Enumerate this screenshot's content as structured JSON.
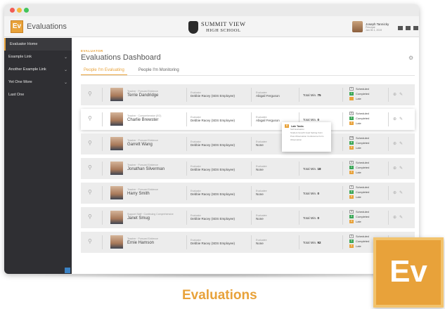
{
  "app": {
    "badge": "Ev",
    "title": "Evaluations"
  },
  "school": {
    "name": "SUMMIT VIEW",
    "sub": "HIGH SCHOOL"
  },
  "user": {
    "name": "Joseph Tannicky",
    "role": "Principal",
    "meta": "Jan 06 1, 2019"
  },
  "sidebar": {
    "items": [
      {
        "label": "Evaluator Home",
        "chevron": false
      },
      {
        "label": "Example Link",
        "chevron": true
      },
      {
        "label": "Another Example Link",
        "chevron": true
      },
      {
        "label": "Yet One More",
        "chevron": true
      },
      {
        "label": "Last One",
        "chevron": false
      }
    ]
  },
  "page": {
    "eyebrow": "EVALUATOR",
    "title": "Evaluations Dashboard"
  },
  "tabs": [
    "People I'm Evaluating",
    "People I'm Monitoring"
  ],
  "labels": {
    "evaluator": "Evaluator",
    "evaluatee": "Evaluatee",
    "total": "Total Min.",
    "scheduled": "Scheduled",
    "completed": "Completed",
    "late": "Late"
  },
  "rows": [
    {
      "role": "Teacher · Pursued Evidence",
      "name": "Terrie Dandridge",
      "evaluator": "Debbie Racey (SDS Employee)",
      "evaluatee": "Abigail Ferguson",
      "total": "75",
      "scheduled": "1",
      "completed": "1",
      "late": ""
    },
    {
      "role": "Teacher · Comprehensive (EO)",
      "name": "Charlie Brewster",
      "evaluator": "Debbie Racey (SDS Employee)",
      "evaluatee": "Abigail Ferguson",
      "total": "0",
      "scheduled": "4",
      "completed": "0",
      "late": "0"
    },
    {
      "role": "Teacher · Pursued Evidence",
      "name": "Garrett Wang",
      "evaluator": "Debbie Racey (SDS Employee)",
      "evaluatee": "None",
      "total": "38",
      "scheduled": "14",
      "completed": "6",
      "late": "0"
    },
    {
      "role": "Teacher · Pursued Evidence",
      "name": "Jonathan Silverman",
      "evaluator": "Debbie Racey (SDS Employee)",
      "evaluatee": "None",
      "total": "18",
      "scheduled": "3",
      "completed": "1",
      "late": "0"
    },
    {
      "role": "Teacher · Pursued Evidence",
      "name": "Harry Smith",
      "evaluator": "Debbie Racey (SDS Employee)",
      "evaluatee": "None",
      "total": "0",
      "scheduled": "3",
      "completed": "0",
      "late": "0"
    },
    {
      "role": "Support Staff · Continuing Comprehensive",
      "name": "Janet Smug",
      "evaluator": "Debbie Racey (SDS Employee)",
      "evaluatee": "None",
      "total": "0",
      "scheduled": "3",
      "completed": "0",
      "late": "0"
    },
    {
      "role": "Teacher · Pursued Evidence",
      "name": "Ernie Hamson",
      "evaluator": "Debbie Racey (SDS Employee)",
      "evaluatee": "None",
      "total": "92",
      "scheduled": "3",
      "completed": "0",
      "late": "0"
    }
  ],
  "popup": {
    "title": "Late Tasks",
    "items": [
      "Self Evaluation",
      "Student Growth Goal Setting Form",
      "Post-Observation Conference Form",
      "Observation"
    ]
  },
  "caption": "Evaluations",
  "colors": {
    "accent": "#e8a23a",
    "sidebar": "#2f2f33",
    "completed": "#3aa656"
  }
}
